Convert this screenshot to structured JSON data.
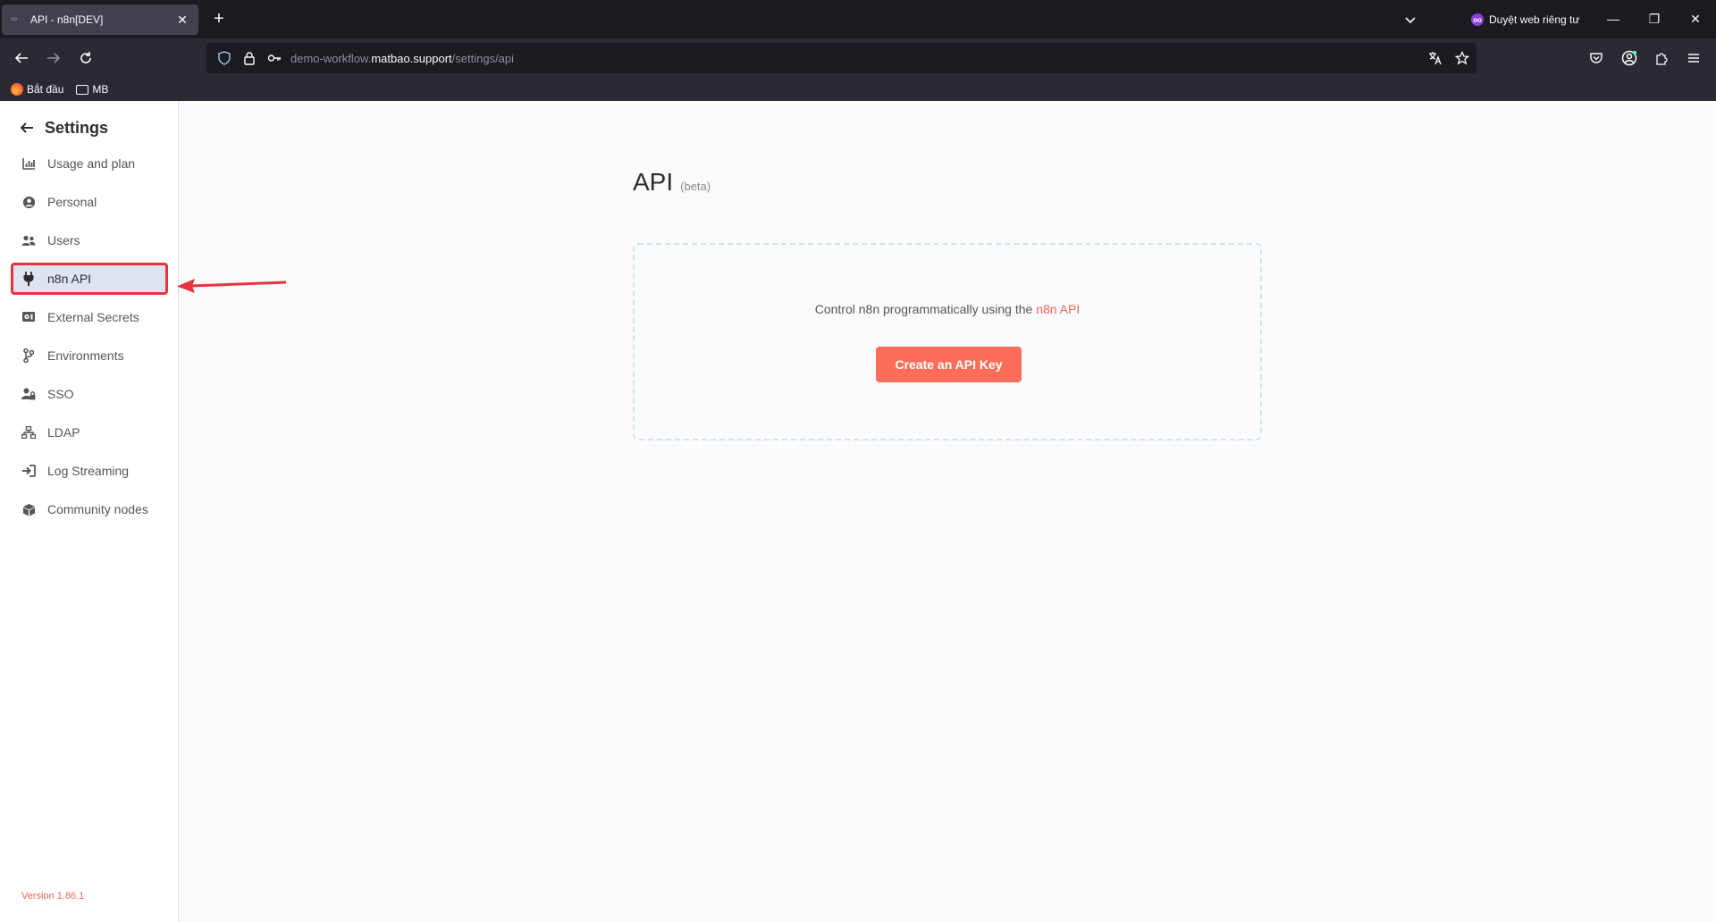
{
  "browser": {
    "tab_title": "API - n8n[DEV]",
    "private_label": "Duyệt web riêng tư",
    "url_prefix": "demo-workflow.",
    "url_host": "matbao.support",
    "url_path": "/settings/api",
    "bookmarks": [
      {
        "label": "Bắt đầu",
        "icon": "firefox-icon"
      },
      {
        "label": "MB",
        "icon": "folder-icon"
      }
    ]
  },
  "sidebar": {
    "title": "Settings",
    "items": [
      {
        "label": "Usage and plan",
        "icon": "chart-icon"
      },
      {
        "label": "Personal",
        "icon": "user-circle-icon"
      },
      {
        "label": "Users",
        "icon": "users-icon"
      },
      {
        "label": "n8n API",
        "icon": "plug-icon",
        "active": true
      },
      {
        "label": "External Secrets",
        "icon": "vault-icon"
      },
      {
        "label": "Environments",
        "icon": "branch-icon"
      },
      {
        "label": "SSO",
        "icon": "user-lock-icon"
      },
      {
        "label": "LDAP",
        "icon": "network-icon"
      },
      {
        "label": "Log Streaming",
        "icon": "sign-in-icon"
      },
      {
        "label": "Community nodes",
        "icon": "cube-icon"
      }
    ],
    "version": "Version 1.86.1"
  },
  "main": {
    "title": "API",
    "title_badge": "(beta)",
    "description_prefix": "Control n8n programmatically using the ",
    "description_link": "n8n API",
    "create_button": "Create an API Key"
  },
  "colors": {
    "accent": "#ff6d5a",
    "highlight_border": "#e8323c",
    "active_bg": "#dee3f0"
  }
}
